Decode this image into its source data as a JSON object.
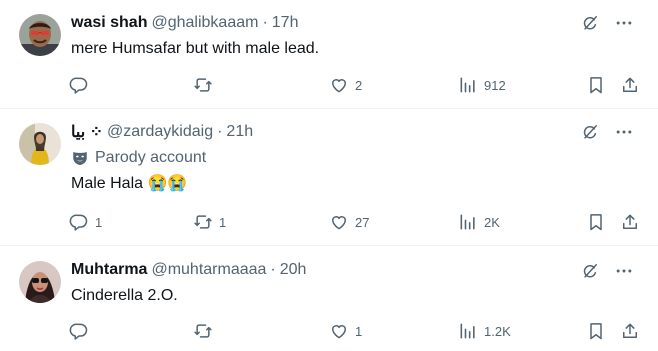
{
  "tweets": [
    {
      "name": "wasi shah",
      "handle": "@ghalibkaaam",
      "time": "17h",
      "text": "mere Humsafar but with male lead.",
      "reply_count": "",
      "retweet_count": "",
      "like_count": "2",
      "views": "912"
    },
    {
      "name": "بیا ⁘",
      "handle": "@zardaykidaig",
      "time": "21h",
      "label": "Parody account",
      "text": "Male Hala 😭😭",
      "reply_count": "1",
      "retweet_count": "1",
      "like_count": "27",
      "views": "2K"
    },
    {
      "name": "Muhtarma",
      "handle": "@muhtarmaaaa",
      "time": "20h",
      "text": "Cinderella 2.O.",
      "reply_count": "",
      "retweet_count": "",
      "like_count": "1",
      "views": "1.2K"
    }
  ],
  "separator": "·",
  "colors": {
    "secondary_text": "#536471",
    "primary_text": "#0f1419",
    "divider": "#eff3f4"
  },
  "icons": [
    "grok-icon",
    "more-icon",
    "reply-icon",
    "retweet-icon",
    "like-icon",
    "views-icon",
    "bookmark-icon",
    "share-icon",
    "parody-mask-icon"
  ]
}
